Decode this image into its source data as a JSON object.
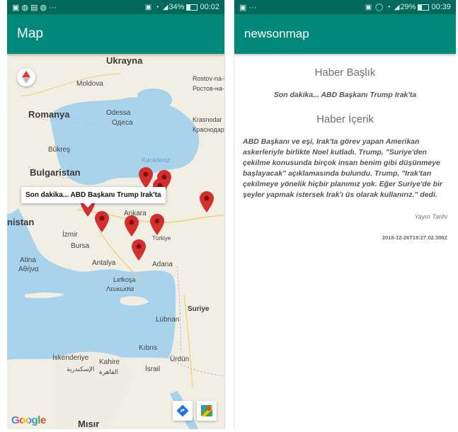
{
  "left_phone": {
    "status": {
      "time": "00:02",
      "battery": "34%",
      "icons_left": "▣ ◍ ▤ ◍ ···"
    },
    "appbar": {
      "title": "Map"
    },
    "map": {
      "labels": {
        "ukraine": "Ukrayna",
        "moldova": "Moldova",
        "rostov": "Rostov-na-Donu",
        "rostov_cyr": "Ростов-на-Дону",
        "romania": "Romanya",
        "odessa": "Odessa",
        "odessa_cyr": "Одеса",
        "krasnodar": "Krasnodar",
        "krasnodar_cyr": "Краснодар",
        "bucharest": "Bükreş",
        "black_sea": "Karadeniz",
        "bulgaria": "Bulgaristan",
        "ankara": "Ankara",
        "turkey": "Türkiye",
        "izmir": "İzmir",
        "bursa": "Bursa",
        "greece_partial": "nistan",
        "athens": "Atina",
        "athens_gr": "Αθήνα",
        "antalya": "Antalya",
        "adana": "Adana",
        "nicosia": "Lefkoşa",
        "nicosia_gr": "Λευκωσία",
        "syria": "Suriye",
        "lebanon": "Lübnan",
        "cyprus": "Kıbrıs",
        "jordan": "Ürdün",
        "alexandria": "İskenderiye",
        "alexandria_ar": "الإسكندرية",
        "cairo": "Kahire",
        "cairo_ar": "القاهرة",
        "israel": "İsrail",
        "egypt": "Mısır"
      },
      "infowindow": "Son dakika... ABD Başkanı Trump Irak'ta",
      "google_logo": "Google",
      "marker_color": "#d32f2f"
    }
  },
  "right_phone": {
    "status": {
      "time": "00:39",
      "battery": "29%",
      "icons_left": "▣ ···"
    },
    "appbar": {
      "title": "newsonmap"
    },
    "title_label": "Haber Başlık",
    "title_value": "Son dakika... ABD Başkanı Trump Irak'ta",
    "content_label": "Haber İçerik",
    "content_value": "ABD Başkanı ve eşi, Irak'ta görev yapan Amerikan askerleriyle birlikte Noel kutladı. Trump, \"Suriye'den çekilme konusunda birçok insan benim gibi düşünmeye başlayacak\" açıklamasında bulundu. Trump, \"Irak'tan çekilmeye yönelik hiçbir planımız yok. Eğer Suriye'de bir şeyler yapmak istersek Irak'ı üs olarak kullanırız.\" dedi.",
    "date_label": "Yayın Tarihi",
    "date_value": "2018-12-26T19:27:02.306Z"
  },
  "colors": {
    "primary": "#00897b",
    "primary_dark": "#00695c"
  }
}
